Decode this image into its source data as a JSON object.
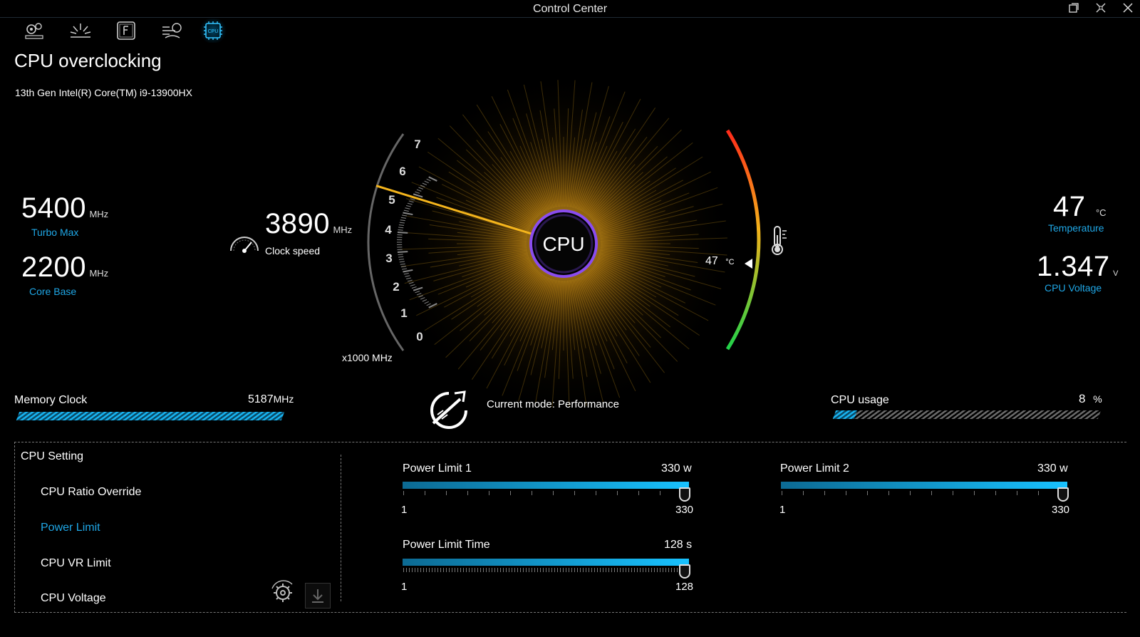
{
  "window": {
    "title": "Control Center"
  },
  "nav": {
    "items": [
      "settings",
      "lighting",
      "fn-key",
      "fan",
      "cpu"
    ],
    "active": "cpu"
  },
  "page": {
    "title": "CPU overclocking",
    "cpu_model": "13th Gen Intel(R) Core(TM) i9-13900HX"
  },
  "stats": {
    "turbo_max": {
      "value": "5400",
      "unit": "MHz",
      "label": "Turbo Max"
    },
    "core_base": {
      "value": "2200",
      "unit": "MHz",
      "label": "Core Base"
    },
    "clock": {
      "value": "3890",
      "unit": "MHz",
      "label": "Clock speed"
    },
    "temperature": {
      "value": "47",
      "unit": "°C",
      "label": "Temperature"
    },
    "voltage": {
      "value": "1.347",
      "unit": "V",
      "label": "CPU Voltage"
    }
  },
  "gauge": {
    "center_label": "CPU",
    "ticks": [
      "0",
      "1",
      "2",
      "3",
      "4",
      "5",
      "6",
      "7"
    ],
    "scale_label": "x1000 MHz",
    "needle_value": 3.89,
    "temp_value": "47",
    "temp_unit": "°C"
  },
  "memory": {
    "label": "Memory Clock",
    "value": "5187",
    "unit": "MHz"
  },
  "mode": {
    "text": "Current mode: Performance"
  },
  "usage": {
    "label": "CPU usage",
    "value": "8",
    "unit": "%",
    "level": 0.08
  },
  "settings": {
    "title": "CPU Setting",
    "menu": [
      "CPU Ratio Override",
      "Power Limit",
      "CPU VR Limit",
      "CPU Voltage"
    ],
    "selected_index": 1
  },
  "sliders": {
    "pl1": {
      "label": "Power Limit 1",
      "value": "330",
      "unit": "w",
      "min": "1",
      "max": "330",
      "level": 1.0
    },
    "pl2": {
      "label": "Power Limit 2",
      "value": "330",
      "unit": "w",
      "min": "1",
      "max": "330",
      "level": 1.0
    },
    "plt": {
      "label": "Power Limit Time",
      "value": "128",
      "unit": "s",
      "min": "1",
      "max": "128",
      "level": 1.0
    }
  },
  "colors": {
    "accent": "#1fa7e6",
    "gauge_glow": "#f2b21c",
    "temp_hot": "#ff3b1f",
    "temp_cool": "#23d14a"
  }
}
